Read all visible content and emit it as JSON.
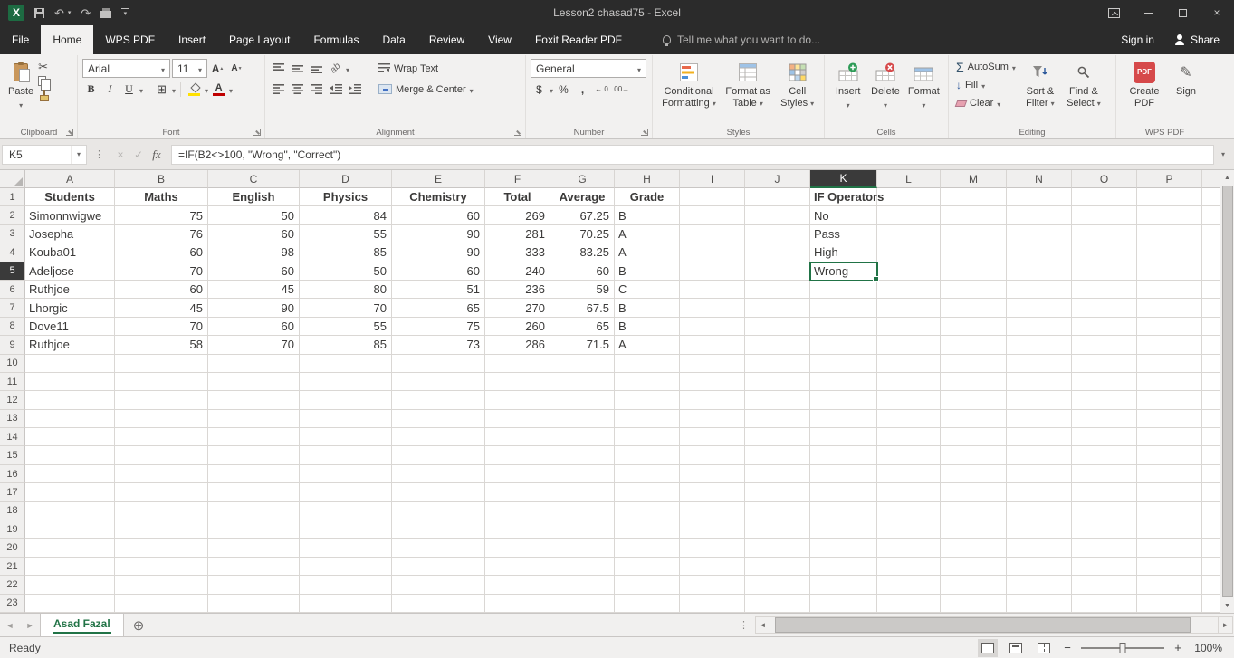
{
  "titlebar": {
    "title": "Lesson2 chasad75 - Excel"
  },
  "tabs": {
    "items": [
      "File",
      "Home",
      "WPS PDF",
      "Insert",
      "Page Layout",
      "Formulas",
      "Data",
      "Review",
      "View",
      "Foxit Reader PDF"
    ],
    "active": "Home",
    "tell_me": "Tell me what you want to do...",
    "sign_in": "Sign in",
    "share": "Share"
  },
  "ribbon": {
    "clipboard": {
      "label": "Clipboard",
      "paste": "Paste"
    },
    "font": {
      "label": "Font",
      "family": "Arial",
      "size": "11",
      "bold": "B",
      "italic": "I",
      "underline": "U"
    },
    "alignment": {
      "label": "Alignment",
      "wrap_text": "Wrap Text",
      "merge_center": "Merge & Center"
    },
    "number": {
      "label": "Number",
      "format": "General"
    },
    "styles": {
      "label": "Styles",
      "conditional": "Conditional Formatting",
      "format_table": "Format as Table",
      "cell_styles": "Cell Styles"
    },
    "cells": {
      "label": "Cells",
      "insert": "Insert",
      "delete": "Delete",
      "format": "Format"
    },
    "editing": {
      "label": "Editing",
      "autosum": "AutoSum",
      "fill": "Fill",
      "clear": "Clear",
      "sort_filter": "Sort & Filter",
      "find_select": "Find & Select"
    },
    "wps": {
      "label": "WPS PDF",
      "create_pdf": "Create PDF",
      "sign": "Sign"
    }
  },
  "formula_bar": {
    "name_box": "K5",
    "formula": "=IF(B2<>100, \"Wrong\", \"Correct\")"
  },
  "grid": {
    "columns": [
      "A",
      "B",
      "C",
      "D",
      "E",
      "F",
      "G",
      "H",
      "I",
      "J",
      "K",
      "L",
      "M",
      "N",
      "O",
      "P"
    ],
    "row_count": 23,
    "selection": {
      "cell": "K5",
      "column": "K",
      "row": 5
    },
    "cells": {
      "A1": "Students",
      "B1": "Maths",
      "C1": "English",
      "D1": "Physics",
      "E1": "Chemistry",
      "F1": "Total",
      "G1": "Average",
      "H1": "Grade",
      "K1": "IF Operators",
      "A2": "Simonnwigwe",
      "B2": 75,
      "C2": 50,
      "D2": 84,
      "E2": 60,
      "F2": 269,
      "G2": 67.25,
      "H2": "B",
      "K2": "No",
      "A3": "Josepha",
      "B3": 76,
      "C3": 60,
      "D3": 55,
      "E3": 90,
      "F3": 281,
      "G3": 70.25,
      "H3": "A",
      "K3": "Pass",
      "A4": "Kouba01",
      "B4": 60,
      "C4": 98,
      "D4": 85,
      "E4": 90,
      "F4": 333,
      "G4": 83.25,
      "H4": "A",
      "K4": "High",
      "A5": "Adeljose",
      "B5": 70,
      "C5": 60,
      "D5": 50,
      "E5": 60,
      "F5": 240,
      "G5": 60,
      "H5": "B",
      "K5": "Wrong",
      "A6": "Ruthjoe",
      "B6": 60,
      "C6": 45,
      "D6": 80,
      "E6": 51,
      "F6": 236,
      "G6": 59,
      "H6": "C",
      "A7": "Lhorgic",
      "B7": 45,
      "C7": 90,
      "D7": 70,
      "E7": 65,
      "F7": 270,
      "G7": 67.5,
      "H7": "B",
      "A8": "Dove11",
      "B8": 70,
      "C8": 60,
      "D8": 55,
      "E8": 75,
      "F8": 260,
      "G8": 65,
      "H8": "B",
      "A9": "Ruthjoe",
      "B9": 58,
      "C9": 70,
      "D9": 85,
      "E9": 73,
      "F9": 286,
      "G9": 71.5,
      "H9": "A"
    }
  },
  "sheet_bar": {
    "active_tab": "Asad Fazal"
  },
  "status_bar": {
    "mode": "Ready",
    "zoom": "100%"
  },
  "colors": {
    "accent_green": "#217346",
    "fill_color_swatch": "#ffe100",
    "font_color_swatch": "#c00000",
    "pdf_red": "#d6494a"
  },
  "icons": {
    "excel_logo": "X",
    "undo": "↶",
    "redo": "↷",
    "close": "×",
    "cut": "✂",
    "borders": "⊞",
    "orientation": "ab",
    "autosum_sigma": "Σ",
    "fill_down": "↓",
    "currency": "$",
    "percent": "%",
    "comma": ",",
    "increase_decimal": "←.0",
    "decrease_decimal": ".00→",
    "cancel": "×",
    "enter": "✓",
    "function": "fx",
    "dots": "⋮",
    "nav_left": "◄",
    "nav_right": "►",
    "add_sheet": "⊕",
    "scroll_up": "▲",
    "scroll_down": "▼",
    "minus": "−",
    "plus": "+",
    "font_color_letter": "A",
    "grow_font_letter": "A",
    "shrink_font_letter": "A",
    "pencil": "✎",
    "pdf_badge": "PDF"
  }
}
